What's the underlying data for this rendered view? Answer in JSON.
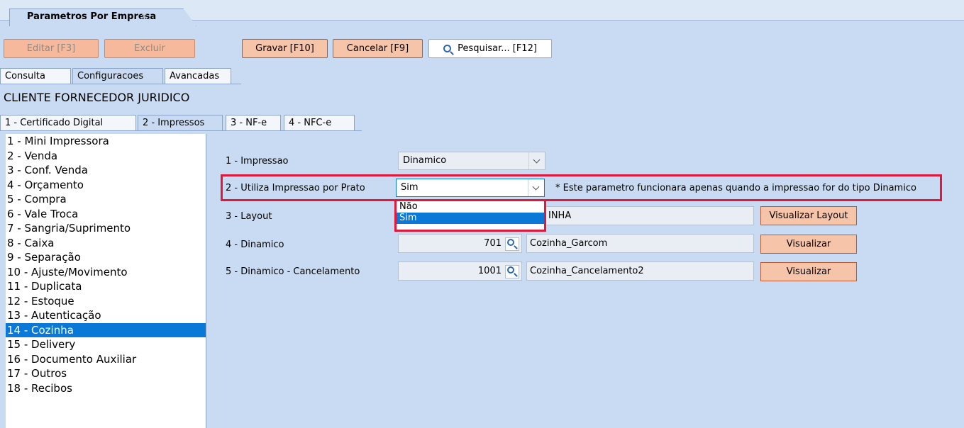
{
  "window_tab": {
    "title": "Parametros Por Empresa"
  },
  "toolbar": {
    "edit": "Editar [F3]",
    "delete": "Excluir",
    "save": "Gravar [F10]",
    "cancel": "Cancelar [F9]",
    "search": "Pesquisar... [F12]"
  },
  "main_tabs": [
    "Consulta",
    "Configuracoes",
    "Avancadas"
  ],
  "section_title": "CLIENTE FORNECEDOR JURIDICO",
  "sub_tabs": [
    "1 - Certificado Digital",
    "2 - Impressos",
    "3 - NF-e",
    "4 - NFC-e"
  ],
  "list_items": [
    "1 - Mini Impressora",
    "2 - Venda",
    "3 - Conf. Venda",
    "4 - Orçamento",
    "5 - Compra",
    "6 - Vale Troca",
    "7 - Sangria/Suprimento",
    "8 - Caixa",
    "9 - Separação",
    "10 - Ajuste/Movimento",
    "11 - Duplicata",
    "12 - Estoque",
    "13 - Autenticação",
    "14 - Cozinha",
    "15 - Delivery",
    "16 - Documento Auxiliar",
    "17 - Outros",
    "18 - Recibos"
  ],
  "selected_list_item": "14 - Cozinha",
  "form": {
    "impressao": {
      "label": "1 - Impressao",
      "value": "Dinamico"
    },
    "prato": {
      "label": "2 - Utiliza Impressao por Prato",
      "value": "Sim",
      "note": "* Este parametro funcionara apenas quando a impressao for do tipo Dinamico",
      "options": [
        "Não",
        "Sim"
      ]
    },
    "layout": {
      "label": "3 - Layout",
      "value": "INHA",
      "button": "Visualizar Layout"
    },
    "dinamico": {
      "label": "4 - Dinamico",
      "code": "701",
      "value": "Cozinha_Garcom",
      "button": "Visualizar"
    },
    "cancelamento": {
      "label": "5 - Dinamico - Cancelamento",
      "code": "1001",
      "value": "Cozinha_Cancelamento2",
      "button": "Visualizar"
    }
  },
  "colors": {
    "background": "#c9dbf3",
    "highlight": "#e2173a",
    "selection": "#0a78d7",
    "button": "#f6c4a8"
  }
}
